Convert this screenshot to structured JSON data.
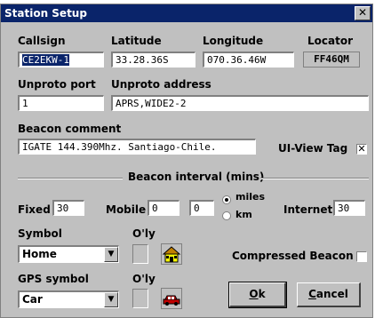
{
  "window": {
    "title": "Station Setup",
    "close_glyph": "✕"
  },
  "labels": {
    "callsign": "Callsign",
    "latitude": "Latitude",
    "longitude": "Longitude",
    "locator": "Locator",
    "unproto_port": "Unproto port",
    "unproto_address": "Unproto address",
    "beacon_comment": "Beacon comment",
    "uiview_tag": "UI-View Tag",
    "beacon_interval": "Beacon interval (mins)",
    "fixed": "Fixed",
    "mobile": "Mobile",
    "miles": "miles",
    "km": "km",
    "internet": "Internet",
    "symbol": "Symbol",
    "oly": "O'ly",
    "compressed_beacon": "Compressed Beacon",
    "gps_symbol": "GPS symbol",
    "oly2": "O'ly"
  },
  "values": {
    "callsign": "CE2EKW-1",
    "latitude": "33.28.36S",
    "longitude": "070.36.46W",
    "locator": "FF46QM",
    "unproto_port": "1",
    "unproto_address": "APRS,WIDE2-2",
    "beacon_comment": "IGATE 144.390Mhz. Santiago-Chile.",
    "fixed": "30",
    "mobile_1": "0",
    "mobile_2": "0",
    "internet": "30",
    "symbol": "Home",
    "gps_symbol": "Car"
  },
  "state": {
    "uiview_tag_checked": true,
    "compressed_beacon_checked": false,
    "distance_unit": "miles"
  },
  "buttons": {
    "ok_underlined": "O",
    "ok_rest": "k",
    "cancel_underlined": "C",
    "cancel_rest": "ancel"
  },
  "icons": {
    "symbol": "house-icon",
    "gps_symbol": "car-icon",
    "dropdown": "chevron-down-icon"
  },
  "colors": {
    "titlebar": "#0a246a",
    "selection": "#0a246a",
    "dialog": "#c0c0c0"
  }
}
